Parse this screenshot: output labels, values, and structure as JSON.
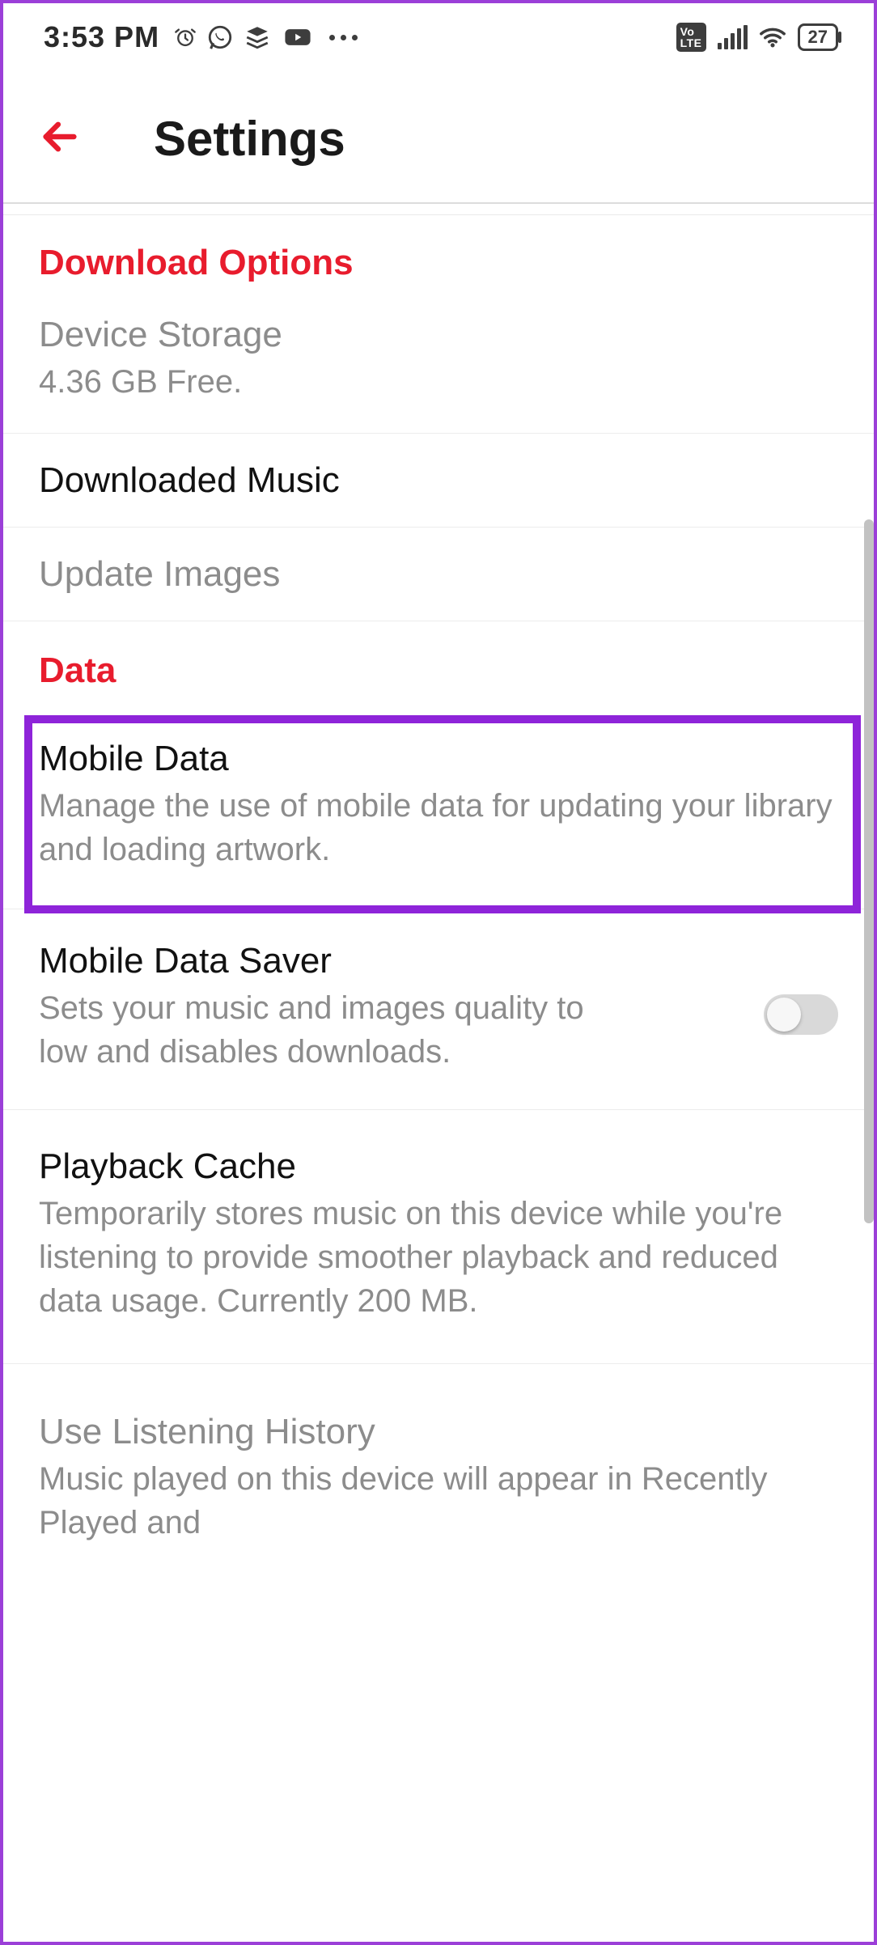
{
  "status": {
    "time": "3:53 PM",
    "battery": "27",
    "icons": [
      "alarm",
      "whatsapp",
      "stack",
      "youtube",
      "more"
    ],
    "right_icons": [
      "volte",
      "signal",
      "wifi",
      "battery"
    ]
  },
  "header": {
    "title": "Settings"
  },
  "sections": {
    "download": {
      "header": "Download Options",
      "storage": {
        "title": "Device Storage",
        "subtitle": "4.36 GB Free."
      },
      "downloaded_music": {
        "title": "Downloaded Music"
      },
      "update_images": {
        "title": "Update Images"
      }
    },
    "data": {
      "header": "Data",
      "mobile_data": {
        "title": "Mobile Data",
        "subtitle": "Manage the use of mobile data for updating your library and loading artwork."
      },
      "mobile_data_saver": {
        "title": "Mobile Data Saver",
        "subtitle": "Sets your music and images quality to low and disables downloads.",
        "enabled": false
      },
      "playback_cache": {
        "title": "Playback Cache",
        "subtitle": "Temporarily stores music on this device while you're listening to provide smoother playback and reduced data usage. Currently 200 MB."
      },
      "listening_history": {
        "title": "Use Listening History",
        "subtitle": "Music played on this device will appear in Recently Played and"
      }
    }
  },
  "colors": {
    "accent": "#e81c2d",
    "highlight": "#8e24d9"
  }
}
